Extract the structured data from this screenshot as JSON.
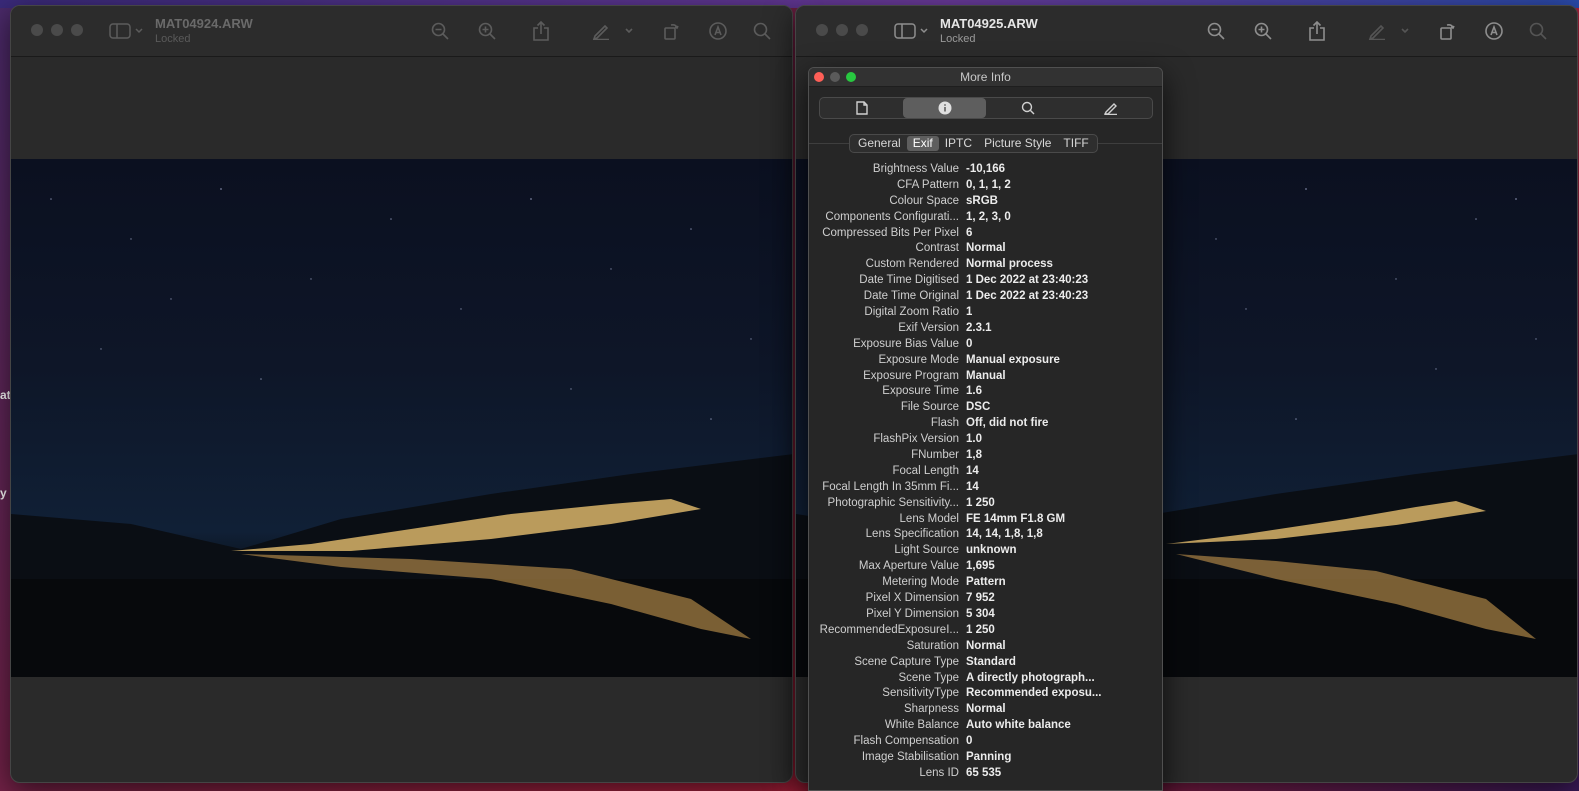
{
  "left_window": {
    "title": "MAT04924.ARW",
    "subtitle": "Locked"
  },
  "right_window": {
    "title": "MAT04925.ARW",
    "subtitle": "Locked"
  },
  "toolbar_icons": [
    "sidebar-icon",
    "zoom-out-icon",
    "zoom-in-icon",
    "share-icon",
    "markup-pen-icon",
    "chevron-down-icon",
    "rotate-icon",
    "markup-circle-icon",
    "search-icon"
  ],
  "edge_text": {
    "left_top": "at",
    "left_bottom": "y"
  },
  "info_panel": {
    "title": "More Info",
    "top_tabs": [
      "document-icon",
      "info-icon",
      "search-icon",
      "pencil-icon"
    ],
    "active_top_tab": 1,
    "subtabs": [
      "General",
      "Exif",
      "IPTC",
      "Picture Style",
      "TIFF"
    ],
    "active_subtab": "Exif",
    "rows": [
      {
        "key": "Brightness Value",
        "value": "-10,166"
      },
      {
        "key": "CFA Pattern",
        "value": "0, 1, 1, 2"
      },
      {
        "key": "Colour Space",
        "value": "sRGB"
      },
      {
        "key": "Components Configurati...",
        "value": "1, 2, 3, 0"
      },
      {
        "key": "Compressed Bits Per Pixel",
        "value": "6"
      },
      {
        "key": "Contrast",
        "value": "Normal"
      },
      {
        "key": "Custom Rendered",
        "value": "Normal process"
      },
      {
        "key": "Date Time Digitised",
        "value": "1 Dec 2022 at 23:40:23"
      },
      {
        "key": "Date Time Original",
        "value": "1 Dec 2022 at 23:40:23"
      },
      {
        "key": "Digital Zoom Ratio",
        "value": "1"
      },
      {
        "key": "Exif Version",
        "value": "2.3.1"
      },
      {
        "key": "Exposure Bias Value",
        "value": "0"
      },
      {
        "key": "Exposure Mode",
        "value": "Manual exposure"
      },
      {
        "key": "Exposure Program",
        "value": "Manual"
      },
      {
        "key": "Exposure Time",
        "value": "1.6"
      },
      {
        "key": "File Source",
        "value": "DSC"
      },
      {
        "key": "Flash",
        "value": "Off, did not fire"
      },
      {
        "key": "FlashPix Version",
        "value": "1.0"
      },
      {
        "key": "FNumber",
        "value": "1,8"
      },
      {
        "key": "Focal Length",
        "value": "14"
      },
      {
        "key": "Focal Length In 35mm Fi...",
        "value": "14"
      },
      {
        "key": "Photographic Sensitivity...",
        "value": "1 250"
      },
      {
        "key": "Lens Model",
        "value": "FE 14mm F1.8 GM"
      },
      {
        "key": "Lens Specification",
        "value": "14, 14, 1,8, 1,8"
      },
      {
        "key": "Light Source",
        "value": "unknown"
      },
      {
        "key": "Max Aperture Value",
        "value": "1,695"
      },
      {
        "key": "Metering Mode",
        "value": "Pattern"
      },
      {
        "key": "Pixel X Dimension",
        "value": "7 952"
      },
      {
        "key": "Pixel Y Dimension",
        "value": "5 304"
      },
      {
        "key": "RecommendedExposureI...",
        "value": "1 250"
      },
      {
        "key": "Saturation",
        "value": "Normal"
      },
      {
        "key": "Scene Capture Type",
        "value": "Standard"
      },
      {
        "key": "Scene Type",
        "value": "A directly photograph..."
      },
      {
        "key": "SensitivityType",
        "value": "Recommended exposu..."
      },
      {
        "key": "Sharpness",
        "value": "Normal"
      },
      {
        "key": "White Balance",
        "value": "Auto white balance"
      },
      {
        "key": "Flash Compensation",
        "value": "0"
      },
      {
        "key": "Image Stabilisation",
        "value": "Panning"
      },
      {
        "key": "Lens ID",
        "value": "65 535"
      }
    ]
  },
  "colors": {
    "close": "#fe5f57",
    "minimize": "#febc2e",
    "zoom": "#28c840"
  }
}
